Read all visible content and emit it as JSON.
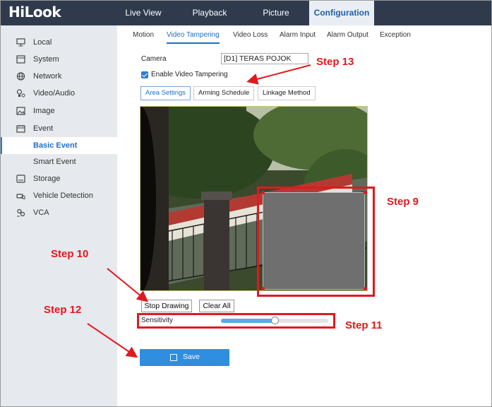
{
  "app": {
    "logo": "HiLook"
  },
  "nav": {
    "live_view": "Live View",
    "playback": "Playback",
    "picture": "Picture",
    "configuration": "Configuration"
  },
  "sidebar": {
    "items": [
      {
        "label": "Local",
        "icon": "monitor-icon"
      },
      {
        "label": "System",
        "icon": "system-window-icon"
      },
      {
        "label": "Network",
        "icon": "globe-icon"
      },
      {
        "label": "Video/Audio",
        "icon": "camera-mic-icon"
      },
      {
        "label": "Image",
        "icon": "image-icon"
      },
      {
        "label": "Event",
        "icon": "calendar-icon"
      },
      {
        "label": "Basic Event",
        "icon": ""
      },
      {
        "label": "Smart Event",
        "icon": ""
      },
      {
        "label": "Storage",
        "icon": "storage-icon"
      },
      {
        "label": "Vehicle Detection",
        "icon": "vehicle-search-icon"
      },
      {
        "label": "VCA",
        "icon": "vca-icon"
      }
    ]
  },
  "subtabs": {
    "motion": "Motion",
    "video_tampering": "Video Tampering",
    "video_loss": "Video Loss",
    "alarm_input": "Alarm Input",
    "alarm_output": "Alarm Output",
    "exception": "Exception"
  },
  "form": {
    "camera_label": "Camera",
    "camera_value": "[D1] TERAS POJOK",
    "enable_label": "Enable Video Tampering",
    "enable_checked": true,
    "area_tabs": {
      "area_settings": "Area Settings",
      "arming_schedule": "Arming Schedule",
      "linkage_method": "Linkage Method"
    },
    "stop_drawing": "Stop Drawing",
    "clear_all": "Clear All",
    "sensitivity_label": "Sensitivity",
    "sensitivity_level": 0.5,
    "save": "Save"
  },
  "annotations": {
    "step9": "Step 9",
    "step10": "Step 10",
    "step11": "Step 11",
    "step12": "Step 12",
    "step13": "Step 13",
    "color": "#e0191e"
  },
  "colors": {
    "topbar": "#2f3b4d",
    "accent": "#2c7bd6",
    "save": "#2f8ee0"
  }
}
